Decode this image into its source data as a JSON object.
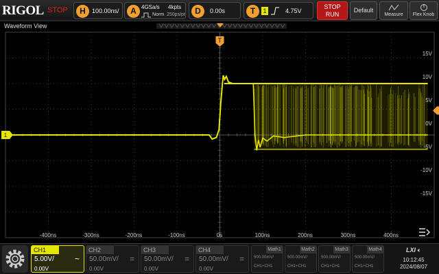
{
  "brand": "RIGOL",
  "run_state": "STOP",
  "horizontal": {
    "badge": "H",
    "timebase": "100.00ns/"
  },
  "acquire": {
    "badge": "A",
    "rate": "4GSa/s",
    "mode": "Norm",
    "points": "4kpts",
    "interval": "250ps/pt"
  },
  "delay": {
    "badge": "D",
    "value": "0.00s"
  },
  "trigger": {
    "badge": "T",
    "source": "1",
    "level": "4.75V"
  },
  "buttons": {
    "stop_run_1": "STOP",
    "stop_run_2": "RUN",
    "default": "Default",
    "measure": "Measure",
    "flex_knob": "Flex Knob"
  },
  "waveform": {
    "title": "Waveform View",
    "trigger_marker": "T",
    "channel_marker": "1",
    "y_labels": [
      "15V",
      "10V",
      "5V",
      "0V",
      "-5V",
      "-10V",
      "-15V"
    ],
    "x_labels": [
      "-400ns",
      "-300ns",
      "-200ns",
      "-100ns",
      "0s",
      "100ns",
      "200ns",
      "300ns",
      "400ns"
    ]
  },
  "channels": [
    {
      "name": "CH1",
      "scale": "5.00V/",
      "offset": "0.00V",
      "symbol": "~",
      "active": true
    },
    {
      "name": "CH2",
      "scale": "50.00mV/",
      "offset": "0.00V",
      "symbol": "=",
      "active": false
    },
    {
      "name": "CH3",
      "scale": "50.00mV/",
      "offset": "0.00V",
      "symbol": "=",
      "active": false
    },
    {
      "name": "CH4",
      "scale": "50.00mV/",
      "offset": "0.00V",
      "symbol": "=",
      "active": false
    }
  ],
  "math": [
    {
      "name": "Math1",
      "scale": "500.00mV/",
      "op": "CH1+CH1"
    },
    {
      "name": "Math2",
      "scale": "500.00mV/",
      "op": "CH1+CH1"
    },
    {
      "name": "Math3",
      "scale": "500.00mV/",
      "op": "CH1+CH1"
    },
    {
      "name": "Math4",
      "scale": "500.00mV/",
      "op": "CH1+CH1"
    }
  ],
  "status": {
    "lxi": "LXI",
    "time": "10:12:45",
    "date": "2024/08/07"
  },
  "colors": {
    "ch1": "#e6e600",
    "trigger": "#f0a030",
    "stop": "#b31818"
  }
}
